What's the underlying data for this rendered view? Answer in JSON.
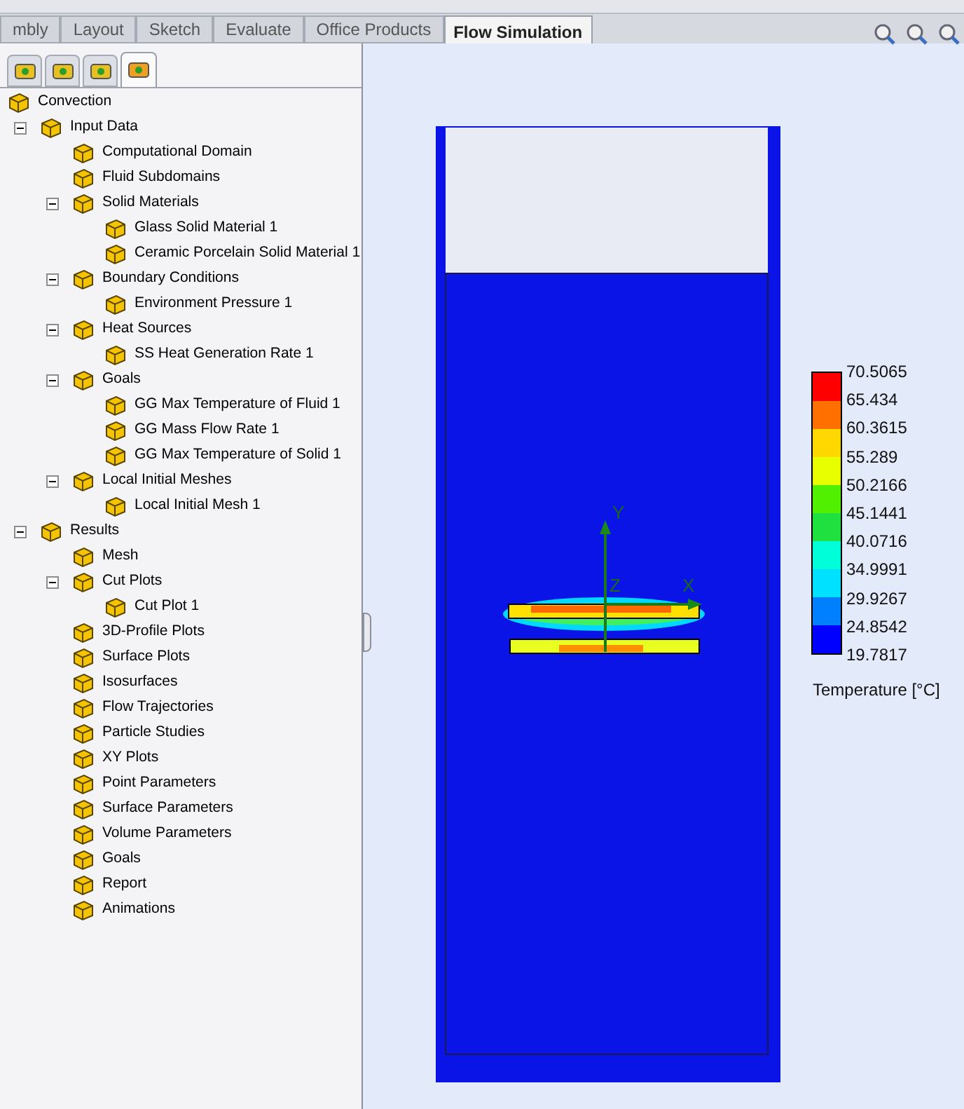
{
  "ribbon_tabs": [
    {
      "label": "mbly",
      "selected": false
    },
    {
      "label": "Layout",
      "selected": false
    },
    {
      "label": "Sketch",
      "selected": false
    },
    {
      "label": "Evaluate",
      "selected": false
    },
    {
      "label": "Office Products",
      "selected": false
    },
    {
      "label": "Flow Simulation",
      "selected": true
    }
  ],
  "panel_tabs": [
    {
      "selected": false
    },
    {
      "selected": false
    },
    {
      "selected": false
    },
    {
      "selected": true
    }
  ],
  "tree": {
    "label": "Convection",
    "children": [
      {
        "label": "Input Data",
        "expanded": true,
        "children": [
          {
            "label": "Computational Domain"
          },
          {
            "label": "Fluid Subdomains"
          },
          {
            "label": "Solid Materials",
            "expanded": true,
            "children": [
              {
                "label": "Glass Solid Material 1"
              },
              {
                "label": "Ceramic Porcelain Solid Material 1"
              }
            ]
          },
          {
            "label": "Boundary Conditions",
            "expanded": true,
            "children": [
              {
                "label": "Environment Pressure 1"
              }
            ]
          },
          {
            "label": "Heat Sources",
            "expanded": true,
            "children": [
              {
                "label": "SS Heat Generation Rate 1"
              }
            ]
          },
          {
            "label": "Goals",
            "expanded": true,
            "children": [
              {
                "label": "GG Max Temperature of Fluid 1"
              },
              {
                "label": "GG Mass Flow Rate 1"
              },
              {
                "label": "GG Max Temperature of Solid 1"
              }
            ]
          },
          {
            "label": "Local Initial Meshes",
            "expanded": true,
            "children": [
              {
                "label": "Local Initial Mesh 1"
              }
            ]
          }
        ]
      },
      {
        "label": "Results",
        "expanded": true,
        "children": [
          {
            "label": "Mesh"
          },
          {
            "label": "Cut Plots",
            "expanded": true,
            "children": [
              {
                "label": "Cut Plot 1"
              }
            ]
          },
          {
            "label": "3D-Profile Plots"
          },
          {
            "label": "Surface Plots"
          },
          {
            "label": "Isosurfaces"
          },
          {
            "label": "Flow Trajectories"
          },
          {
            "label": "Particle Studies"
          },
          {
            "label": "XY Plots"
          },
          {
            "label": "Point Parameters"
          },
          {
            "label": "Surface Parameters"
          },
          {
            "label": "Volume Parameters"
          },
          {
            "label": "Goals"
          },
          {
            "label": "Report"
          },
          {
            "label": "Animations"
          }
        ]
      }
    ]
  },
  "triad": {
    "y": "Y",
    "z": "Z",
    "x": "X"
  },
  "legend": {
    "title": "Temperature [°C]",
    "labels": [
      "70.5065",
      "65.434",
      "60.3615",
      "55.289",
      "50.2166",
      "45.1441",
      "40.0716",
      "34.9991",
      "29.9267",
      "24.8542",
      "19.7817"
    ],
    "bands": [
      {
        "color": "#ff0000"
      },
      {
        "color": "#ff7000"
      },
      {
        "color": "#ffd800"
      },
      {
        "color": "#e8ff00"
      },
      {
        "color": "#50f000"
      },
      {
        "color": "#20e040"
      },
      {
        "color": "#00ffd8"
      },
      {
        "color": "#00e0ff"
      },
      {
        "color": "#0080ff"
      },
      {
        "color": "#0000ff"
      }
    ]
  }
}
